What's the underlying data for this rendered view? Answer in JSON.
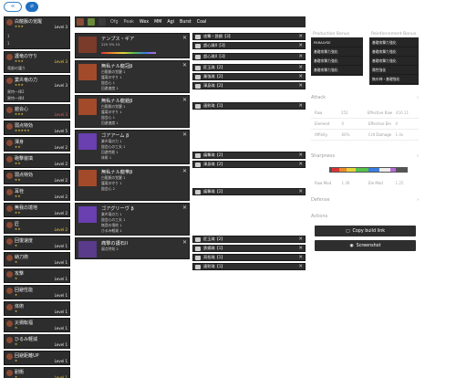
{
  "top": {
    "btn_a": "≪",
    "btn_b": "⇄"
  },
  "skills": [
    {
      "name": "白龍脈の覚醒",
      "lines": [
        {
          "n": "1",
          "t": ""
        },
        {
          "n": "1",
          "t": ""
        }
      ],
      "level": "Level 3",
      "lv_color": "",
      "pips": "★★★",
      "h": 36
    },
    {
      "name": "護竜の守り",
      "sub": "竜脈の護り",
      "level": "Level 3",
      "lv_color": "yel",
      "pips": "★★★",
      "h": 24
    },
    {
      "name": "業炎竜の力",
      "sub": "異特一律2",
      "sub2": "異特一律4",
      "level": "Level 3",
      "lv_color": "",
      "pips": "★★★",
      "h": 30
    },
    {
      "name": "鎧会心",
      "level": "Level 3",
      "lv_color": "red",
      "pips": "★★★",
      "h": 16
    },
    {
      "name": "弱点特効",
      "level": "Level 5",
      "lv_color": "",
      "pips": "★★★★★",
      "h": 16
    },
    {
      "name": "渾身",
      "level": "Level 2",
      "lv_color": "",
      "pips": "★★",
      "h": 16
    },
    {
      "name": "砲撃装填",
      "level": "Level 2",
      "lv_color": "",
      "pips": "★★",
      "h": 16
    },
    {
      "name": "弱点特効",
      "level": "Level 2",
      "lv_color": "",
      "pips": "★★",
      "h": 16
    },
    {
      "name": "耳栓",
      "level": "Level 2",
      "lv_color": "",
      "pips": "★★",
      "h": 16
    },
    {
      "name": "無我の境地",
      "level": "Level 2",
      "lv_color": "",
      "pips": "★★",
      "h": 16
    },
    {
      "name": "匠",
      "level": "Level 2",
      "lv_color": "yel",
      "pips": "★★",
      "h": 16
    },
    {
      "name": "回復速度",
      "level": "Level 1",
      "lv_color": "",
      "pips": "★",
      "h": 16
    },
    {
      "name": "納刀術",
      "level": "Level 1",
      "lv_color": "",
      "pips": "★",
      "h": 16
    },
    {
      "name": "攻撃",
      "level": "Level 1",
      "lv_color": "",
      "pips": "★",
      "h": 16
    },
    {
      "name": "回避性能",
      "level": "Level 1",
      "lv_color": "",
      "pips": "★",
      "h": 16
    },
    {
      "name": "体術",
      "level": "Level 1",
      "lv_color": "",
      "pips": "★",
      "h": 16
    },
    {
      "name": "災禍転福",
      "level": "Level 1",
      "lv_color": "",
      "pips": "★",
      "h": 16
    },
    {
      "name": "ひるみ軽減",
      "level": "Level 1",
      "lv_color": "",
      "pips": "★",
      "h": 16
    },
    {
      "name": "回避距離UP",
      "level": "Level 1",
      "lv_color": "",
      "pips": "★",
      "h": 16
    },
    {
      "name": "耐衝",
      "level": "Level 1",
      "lv_color": "yel",
      "pips": "★",
      "h": 16
    }
  ],
  "topbar": {
    "tabs": [
      "Ofg",
      "Peak",
      "Wex",
      "MM",
      "Agi",
      "Burst",
      "Coal"
    ],
    "active": [
      2,
      3,
      4,
      5,
      6
    ]
  },
  "gear": [
    {
      "title": "テンプス・ギア",
      "lines": [
        "220   5%   15"
      ],
      "h": 28,
      "color": "#7a3b2a",
      "weapon": true
    },
    {
      "title": "無私ナル龍冠β",
      "lines": [
        "白龍脈の覚醒 1",
        "護竜の守り 1",
        "鎧会心 1",
        "回避速度 1"
      ],
      "h": 36,
      "color": "#a34a2a"
    },
    {
      "title": "無私ナル龍鎧β",
      "lines": [
        "白龍脈の覚醒 1",
        "護竜の守り 1",
        "鎧会心 1",
        "回避速度 1"
      ],
      "h": 36,
      "color": "#a34a2a"
    },
    {
      "title": "ゴアアーム β",
      "lines": [
        "業炎竜の力 1",
        "鎧会心の工夫 1",
        "回避性能 1",
        "体術 1"
      ],
      "h": 38,
      "color": "#6a3fb0"
    },
    {
      "title": "無私ナル龍帯β",
      "lines": [
        "白龍脈の覚醒 1",
        "護竜の守り 1",
        "鎧会心 2"
      ],
      "h": 38,
      "color": "#a34a2a"
    },
    {
      "title": "ゴアグリーヴ β",
      "lines": [
        "業炎竜の力 1",
        "鎧会心の工夫 1",
        "無我の境地 1",
        "ひるみ軽減 1"
      ],
      "h": 36,
      "color": "#6a3fb0"
    },
    {
      "title": "痛撃の護石II",
      "lines": [
        "弱点特効 2"
      ],
      "h": 24,
      "color": "#5a3a8a"
    }
  ],
  "deco": [
    {
      "label": "攻撃・鉄鋼【3】",
      "gap": 0
    },
    {
      "label": "超心珠II【3】",
      "gap": 0
    },
    {
      "label": "超心珠II【3】",
      "gap": 4
    },
    {
      "label": "匠玉珠【2】",
      "gap": 4
    },
    {
      "label": "業強珠【2】",
      "gap": 0
    },
    {
      "label": "渾身珠【2】",
      "gap": 0
    },
    {
      "label": "速射珠【1】",
      "gap": 14
    },
    {
      "label": "痛撃珠【2】",
      "gap": 46
    },
    {
      "label": "渾身珠【2】",
      "gap": 0
    },
    {
      "label": "痛撃珠【2】",
      "gap": 22
    },
    {
      "label": "匠玉珠【2】",
      "gap": 44
    },
    {
      "label": "鉄鋼珠【1】",
      "gap": 0
    },
    {
      "label": "耳栓珠【1】",
      "gap": 0
    },
    {
      "label": "速射珠【1】",
      "gap": 0
    }
  ],
  "right": {
    "prod_header": "Production Bonus",
    "reinf_header": "Reinforcement Bonus",
    "prod_rows": [
      "PARALYSE",
      "基礎攻撃力強化",
      "基礎攻撃力強化",
      "基礎攻撃力強化"
    ],
    "reinf_rows": [
      "基礎攻撃力強化",
      "基礎攻撃力強化",
      "基礎攻撃力強化",
      "属性強化",
      "無の神・基礎強化"
    ],
    "attack_header": "Attack",
    "stats": [
      [
        "Raw",
        "252",
        "Effective Raw",
        "416.11"
      ],
      [
        "Element",
        "0",
        "Effective Ele",
        "0"
      ],
      [
        "Affinity",
        "60%",
        "Crit Damage",
        "1.4x"
      ]
    ],
    "sharp_header": "Sharpness",
    "sharp_stats": [
      "Raw Mod",
      "1.39",
      "Ele Mod",
      "1.25"
    ],
    "defense_header": "Defense",
    "actions_header": "Actions",
    "copy_label": "Copy build link",
    "screenshot_label": "Screenshot"
  },
  "colors": {
    "panel": "#2d2d2d",
    "accent": "#1f6fc1",
    "gold": "#e7c44a"
  }
}
